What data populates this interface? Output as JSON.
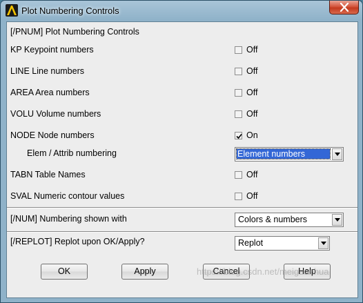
{
  "window": {
    "title": "Plot Numbering Controls",
    "close_icon": "close-x-icon"
  },
  "header": {
    "label": "[/PNUM]  Plot Numbering Controls"
  },
  "rows": [
    {
      "key": "kp",
      "label": "KP    Keypoint numbers",
      "checked": false,
      "state": "Off"
    },
    {
      "key": "line",
      "label": "LINE  Line numbers",
      "checked": false,
      "state": "Off"
    },
    {
      "key": "area",
      "label": "AREA  Area numbers",
      "checked": false,
      "state": "Off"
    },
    {
      "key": "volu",
      "label": "VOLU  Volume numbers",
      "checked": false,
      "state": "Off"
    },
    {
      "key": "node",
      "label": "NODE  Node numbers",
      "checked": true,
      "state": "On"
    }
  ],
  "elem": {
    "label": "Elem / Attrib numbering",
    "value": "Element numbers"
  },
  "rows2": [
    {
      "key": "tabn",
      "label": "TABN  Table Names",
      "checked": false,
      "state": "Off"
    },
    {
      "key": "sval",
      "label": "SVAL  Numeric contour values",
      "checked": false,
      "state": "Off"
    }
  ],
  "num": {
    "label": "[/NUM]  Numbering shown with",
    "value": "Colors & numbers"
  },
  "replot": {
    "label": "[/REPLOT] Replot upon OK/Apply?",
    "value": "Replot"
  },
  "buttons": {
    "ok": "OK",
    "apply": "Apply",
    "cancel": "Cancel",
    "help": "Help"
  },
  "watermark": "https://blog.csdn.net/meiguanhua"
}
